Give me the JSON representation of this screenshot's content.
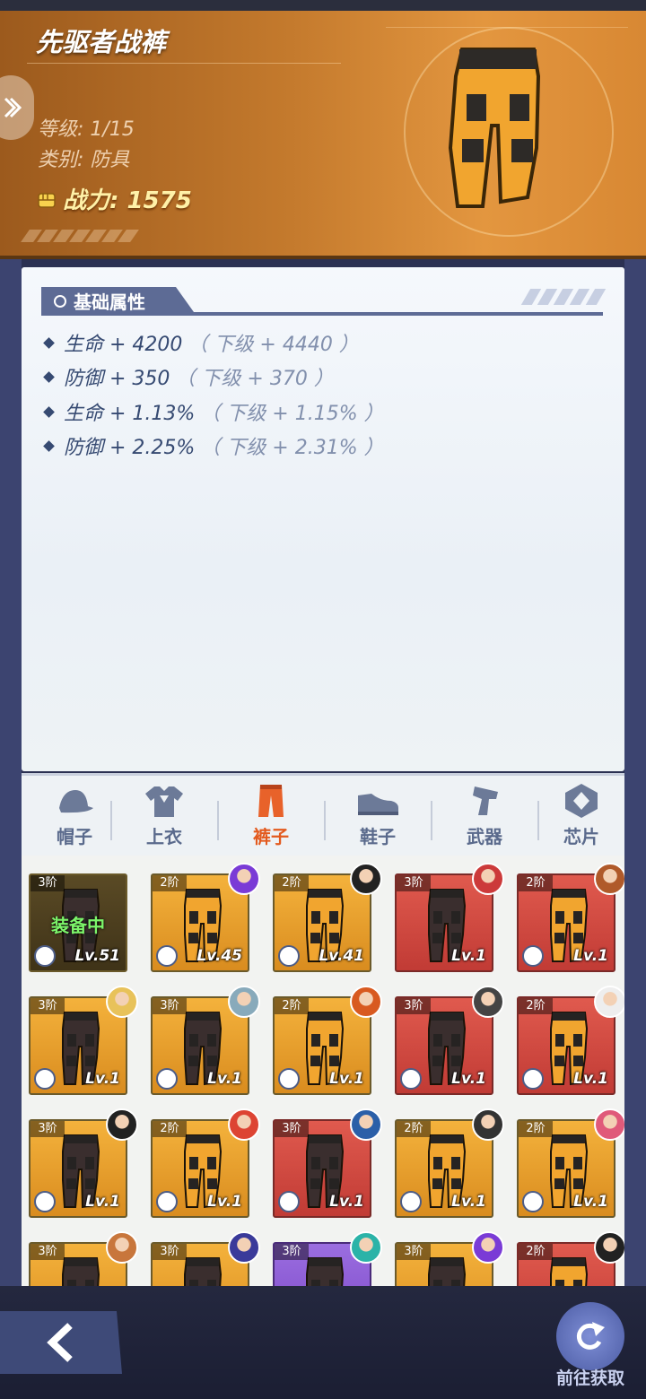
{
  "item": {
    "name": "先驱者战裤",
    "level": "等级: 1/15",
    "type": "类别: 防具",
    "power": "战力: 1575"
  },
  "section": {
    "title": "基础属性"
  },
  "stats": [
    {
      "main": "生命 + 4200",
      "next": "（ 下级 + 4440 ）"
    },
    {
      "main": "防御 + 350",
      "next": "（ 下级 + 370 ）"
    },
    {
      "main": "生命 + 1.13%",
      "next": "（ 下级 + 1.15% ）"
    },
    {
      "main": "防御 + 2.25%",
      "next": "（ 下级 + 2.31% ）"
    }
  ],
  "tabs": [
    {
      "label": "帽子",
      "icon": "hat-icon"
    },
    {
      "label": "上衣",
      "icon": "shirt-icon"
    },
    {
      "label": "裤子",
      "icon": "pants-icon",
      "active": true
    },
    {
      "label": "鞋子",
      "icon": "shoe-icon"
    },
    {
      "label": "武器",
      "icon": "gun-icon"
    },
    {
      "label": "芯片",
      "icon": "chip-icon"
    }
  ],
  "grid": [
    {
      "tier": "3阶",
      "lv": "Lv.51",
      "equipped": "装备中",
      "color": "dark",
      "pants": "black"
    },
    {
      "tier": "2阶",
      "lv": "Lv.45",
      "color": "gold",
      "pants": "orange"
    },
    {
      "tier": "2阶",
      "lv": "Lv.41",
      "color": "gold",
      "pants": "orange"
    },
    {
      "tier": "3阶",
      "lv": "Lv.1",
      "color": "red",
      "pants": "black"
    },
    {
      "tier": "2阶",
      "lv": "Lv.1",
      "color": "red",
      "pants": "orange"
    },
    {
      "tier": "3阶",
      "lv": "Lv.1",
      "color": "gold",
      "pants": "black"
    },
    {
      "tier": "3阶",
      "lv": "Lv.1",
      "color": "gold",
      "pants": "black"
    },
    {
      "tier": "2阶",
      "lv": "Lv.1",
      "color": "gold",
      "pants": "orange"
    },
    {
      "tier": "3阶",
      "lv": "Lv.1",
      "color": "red",
      "pants": "black"
    },
    {
      "tier": "2阶",
      "lv": "Lv.1",
      "color": "red",
      "pants": "orange"
    },
    {
      "tier": "3阶",
      "lv": "Lv.1",
      "color": "gold",
      "pants": "black"
    },
    {
      "tier": "2阶",
      "lv": "Lv.1",
      "color": "gold",
      "pants": "orange"
    },
    {
      "tier": "3阶",
      "lv": "Lv.1",
      "color": "red",
      "pants": "black"
    },
    {
      "tier": "2阶",
      "lv": "Lv.1",
      "color": "gold",
      "pants": "orange"
    },
    {
      "tier": "2阶",
      "lv": "Lv.1",
      "color": "gold",
      "pants": "orange"
    },
    {
      "tier": "3阶",
      "lv": "",
      "color": "gold",
      "pants": "black"
    },
    {
      "tier": "3阶",
      "lv": "",
      "color": "gold",
      "pants": "black"
    },
    {
      "tier": "3阶",
      "lv": "",
      "color": "purple",
      "pants": "black"
    },
    {
      "tier": "3阶",
      "lv": "",
      "color": "gold",
      "pants": "black"
    },
    {
      "tier": "2阶",
      "lv": "",
      "color": "red",
      "pants": "orange"
    }
  ],
  "bottom": {
    "goto_label": "前往获取"
  },
  "colors": {
    "accent_orange": "#e35a1e",
    "panel_blue": "#5d6b95"
  }
}
